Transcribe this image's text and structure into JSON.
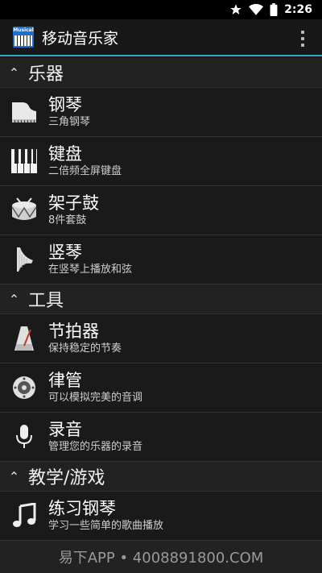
{
  "status_bar": {
    "time": "2:26"
  },
  "app_bar": {
    "title": "移动音乐家",
    "icon_text": "Musical"
  },
  "sections": [
    {
      "label": "乐器",
      "items": [
        {
          "title": "钢琴",
          "subtitle": "三角钢琴",
          "icon": "grand-piano-icon"
        },
        {
          "title": "键盘",
          "subtitle": "二倍频全屏键盘",
          "icon": "keyboard-icon"
        },
        {
          "title": "架子鼓",
          "subtitle": "8件套鼓",
          "icon": "drum-icon"
        },
        {
          "title": "竖琴",
          "subtitle": "在竖琴上播放和弦",
          "icon": "harp-icon"
        }
      ]
    },
    {
      "label": "工具",
      "items": [
        {
          "title": "节拍器",
          "subtitle": "保持稳定的节奏",
          "icon": "metronome-icon"
        },
        {
          "title": "律管",
          "subtitle": "可以模拟完美的音调",
          "icon": "pitch-pipe-icon"
        },
        {
          "title": "录音",
          "subtitle": "管理您的乐器的录音",
          "icon": "microphone-icon"
        }
      ]
    },
    {
      "label": "教学/游戏",
      "items": [
        {
          "title": "练习钢琴",
          "subtitle": "学习一些简单的歌曲播放",
          "icon": "music-note-icon"
        }
      ]
    }
  ],
  "footer": {
    "text": "易下APP • 4008891800.COM"
  }
}
